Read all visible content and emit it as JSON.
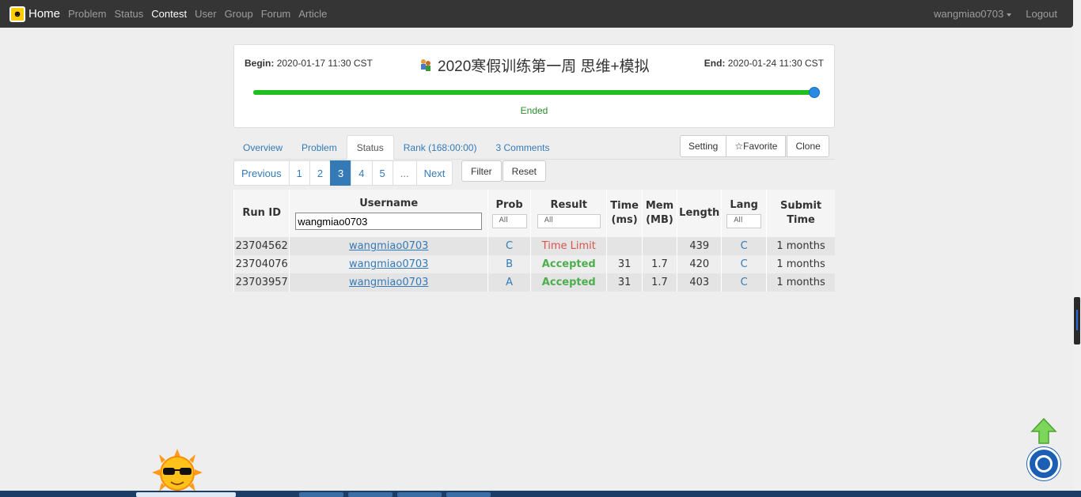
{
  "navbar": {
    "brand": "Home",
    "links": [
      "Problem",
      "Status",
      "Contest",
      "User",
      "Group",
      "Forum",
      "Article"
    ],
    "active": "Contest",
    "user": "wangmiao0703",
    "logout": "Logout"
  },
  "contest": {
    "begin_label": "Begin:",
    "begin": "2020-01-17 11:30 CST",
    "end_label": "End:",
    "end": "2020-01-24 11:30 CST",
    "title": "2020寒假训练第一周 思维+模拟",
    "status": "Ended",
    "progress": 1.0
  },
  "tabs": [
    "Overview",
    "Problem",
    "Status",
    "Rank (168:00:00)",
    "3 Comments"
  ],
  "active_tab": "Status",
  "tools": [
    "Setting",
    "☆Favorite",
    "Clone"
  ],
  "pager": [
    "Previous",
    "1",
    "2",
    "3",
    "4",
    "5",
    "...",
    "Next"
  ],
  "pager_active": "3",
  "filters": [
    "Filter",
    "Reset"
  ],
  "table": {
    "headers": {
      "run_id": "Run ID",
      "username": "Username",
      "prob": "Prob",
      "result": "Result",
      "time": "Time",
      "time_unit": "(ms)",
      "mem": "Mem",
      "mem_unit": "(MB)",
      "length": "Length",
      "lang": "Lang",
      "submit": "Submit",
      "submit2": "Time"
    },
    "username_filter": "wangmiao0703",
    "select_all": "All",
    "rows": [
      {
        "run_id": "23704562",
        "user": "wangmiao0703",
        "prob": "C",
        "result": "Time Limit",
        "time": "",
        "mem": "",
        "length": "439",
        "lang": "C",
        "submit": "1 months"
      },
      {
        "run_id": "23704076",
        "user": "wangmiao0703",
        "prob": "B",
        "result": "Accepted",
        "time": "31",
        "mem": "1.7",
        "length": "420",
        "lang": "C",
        "submit": "1 months"
      },
      {
        "run_id": "23703957",
        "user": "wangmiao0703",
        "prob": "A",
        "result": "Accepted",
        "time": "31",
        "mem": "1.7",
        "length": "403",
        "lang": "C",
        "submit": "1 months"
      }
    ]
  },
  "colors": {
    "accent": "#337ab7",
    "accepted": "#4cae4c",
    "time_limit": "#d9534f",
    "progress": "#1fbf1f"
  }
}
